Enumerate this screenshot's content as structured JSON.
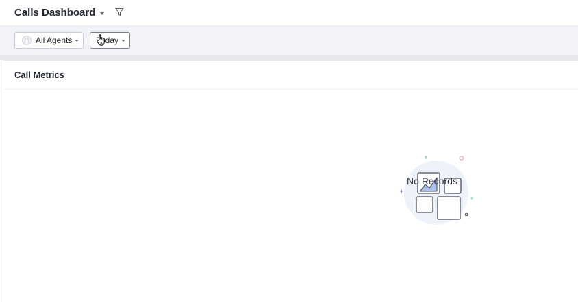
{
  "header": {
    "title": "Calls Dashboard",
    "title_dropdown_icon": "chevron-down-icon",
    "filter_icon": "funnel-icon"
  },
  "filters": {
    "agents_label": "All Agents",
    "agents_icon": "user-avatar-icon",
    "date_label": "Today"
  },
  "panel": {
    "title": "Call Metrics",
    "empty_state": {
      "icon": "charts-illustration-icon",
      "message": "No Records"
    }
  },
  "colors": {
    "filter_bar_bg": "#f1f3f8",
    "illustration_blob": "#e9eef8",
    "illustration_accent": "#a9c1e8"
  }
}
